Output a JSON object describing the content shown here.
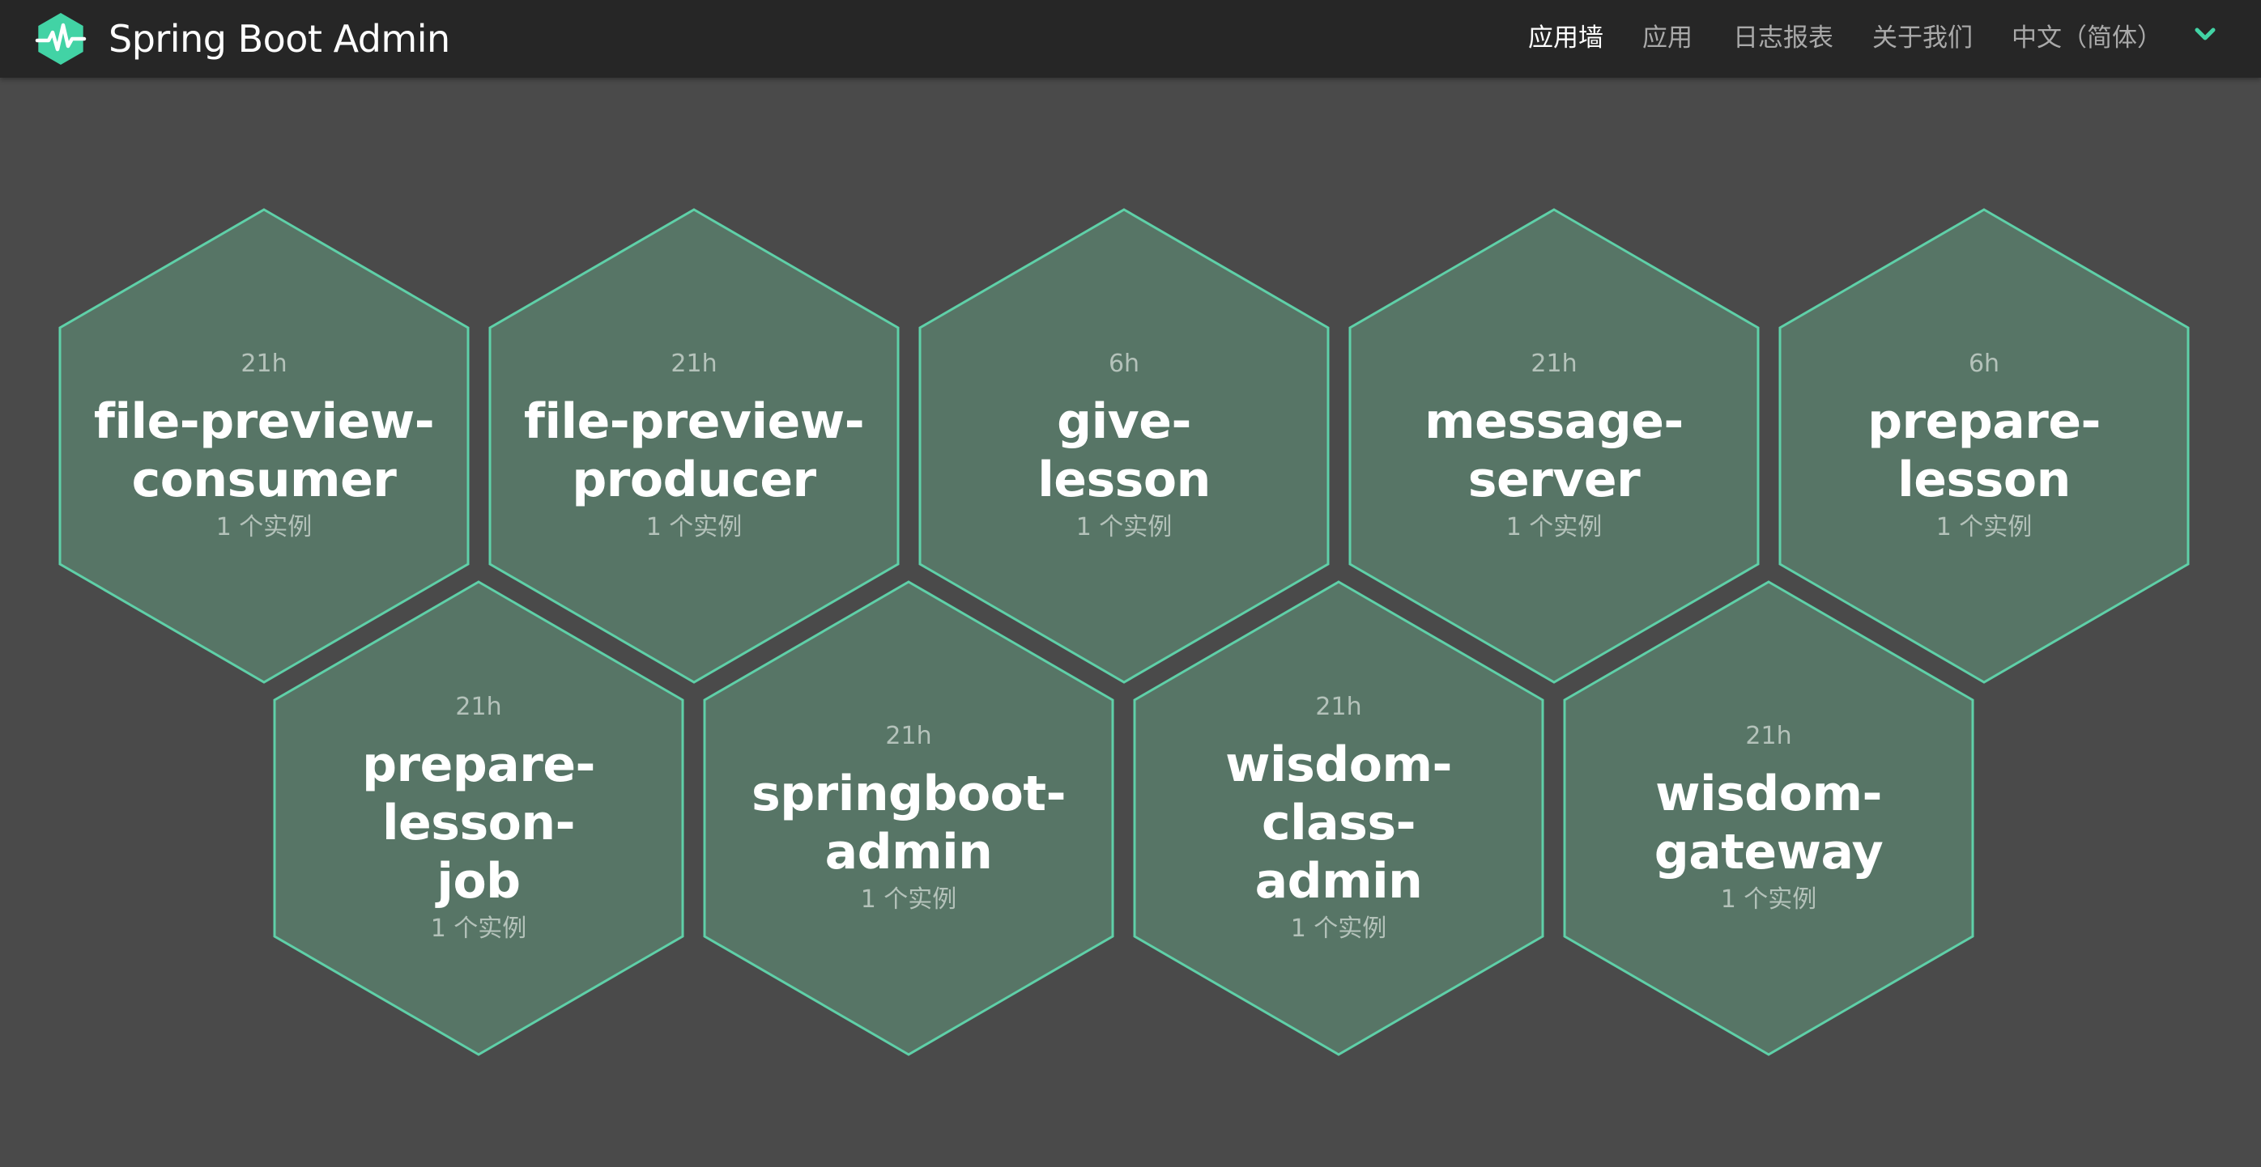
{
  "brand": {
    "title": "Spring Boot Admin",
    "logo_icon": "heartbeat-hexagon-icon",
    "accent_color": "#42d3a5"
  },
  "nav": {
    "items": [
      {
        "label": "应用墙",
        "active": true
      },
      {
        "label": "应用",
        "active": false
      },
      {
        "label": "日志报表",
        "active": false
      },
      {
        "label": "关于我们",
        "active": false
      }
    ],
    "language": {
      "label": "中文（简体）",
      "icon": "chevron-down-icon"
    }
  },
  "applications": [
    {
      "name_line1": "file-preview-",
      "name_line2": "consumer",
      "age": "21h",
      "instances": "1 个实例",
      "status": "UP"
    },
    {
      "name_line1": "file-preview-",
      "name_line2": "producer",
      "age": "21h",
      "instances": "1 个实例",
      "status": "UP"
    },
    {
      "name_line1": "give-",
      "name_line2": "lesson",
      "age": "6h",
      "instances": "1 个实例",
      "status": "UP"
    },
    {
      "name_line1": "message-",
      "name_line2": "server",
      "age": "21h",
      "instances": "1 个实例",
      "status": "UP"
    },
    {
      "name_line1": "prepare-",
      "name_line2": "lesson",
      "age": "6h",
      "instances": "1 个实例",
      "status": "UP"
    },
    {
      "name_line1": "prepare-lesson-",
      "name_line2": "job",
      "age": "21h",
      "instances": "1 个实例",
      "status": "UP"
    },
    {
      "name_line1": "springboot-",
      "name_line2": "admin",
      "age": "21h",
      "instances": "1 个实例",
      "status": "UP"
    },
    {
      "name_line1": "wisdom-class-",
      "name_line2": "admin",
      "age": "21h",
      "instances": "1 个实例",
      "status": "UP"
    },
    {
      "name_line1": "wisdom-",
      "name_line2": "gateway",
      "age": "21h",
      "instances": "1 个实例",
      "status": "UP"
    }
  ],
  "colors": {
    "page_background": "#4a4a4a",
    "navbar_background": "#262626",
    "hex_fill": "#577566",
    "hex_border": "#5fd0a8"
  }
}
